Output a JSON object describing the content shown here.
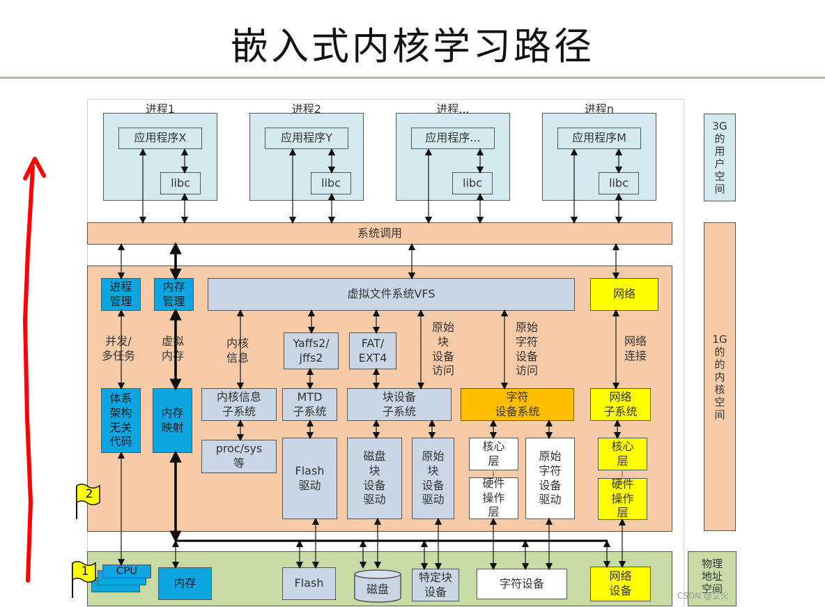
{
  "title": "嵌入式内核学习路径",
  "user_space": {
    "side_label": "3G\n的\n用\n户\n空\n间",
    "processes": [
      {
        "label": "进程1",
        "app": "应用程序X",
        "libc": "libc"
      },
      {
        "label": "进程2",
        "app": "应用程序Y",
        "libc": "libc"
      },
      {
        "label": "进程...",
        "app": "应用程序...",
        "libc": "libc"
      },
      {
        "label": "进程n",
        "app": "应用程序M",
        "libc": "libc"
      }
    ]
  },
  "syscall": {
    "label": "系统调用"
  },
  "kernel": {
    "side_label": "1G\n的\n的\n内\n核\n空\n间",
    "process_mgmt": "进程\n管理",
    "memory_mgmt": "内存\n管理",
    "vfs": "虚拟文件系统VFS",
    "network": "网络",
    "edge_labels": {
      "concurrency": "并发/\n多任务",
      "virtual_memory": "虚拟\n内存",
      "kernel_info": "内核\n信息",
      "raw_block_access": "原始\n块\n设备\n访问",
      "raw_char_access": "原始\n字符\n设备\n访问",
      "net_connect": "网络\n连接"
    },
    "yaffs": "Yaffs2/\njffs2",
    "fat": "FAT/\nEXT4",
    "arch_code": "体系\n架构\n无关\n代码",
    "mem_map": "内存\n映射",
    "kinfo_subsys": "内核信息\n子系统",
    "mtd_subsys": "MTD\n子系统",
    "block_subsys": "块设备\n子系统",
    "char_subsys": "字符\n设备系统",
    "net_subsys": "网络\n子系统",
    "procsys": "proc/sys\n等",
    "flash_driver": "Flash\n驱动",
    "disk_driver": "磁盘\n块\n设备\n驱动",
    "raw_block_driver": "原始\n块\n设备\n驱动",
    "char_core": "核心\n层",
    "char_hw": "硬件\n操作\n层",
    "raw_char_driver": "原始\n字符\n设备\n驱动",
    "net_core": "核心\n层",
    "net_hw": "硬件\n操作\n层"
  },
  "hardware": {
    "side_label": "物理\n地址\n空间",
    "cpu": "CPU",
    "memory": "内存",
    "flash": "Flash",
    "disk": "磁盘",
    "special_block": "特定块\n设备",
    "char_device": "字符设备",
    "net_device": "网络\n设备"
  },
  "flags": [
    {
      "label": "1"
    },
    {
      "label": "2"
    }
  ],
  "watermark": "CSDN @艾火",
  "colors": {
    "arrow": "#ff0000",
    "kernel_bg": "#f8cba8",
    "hardware_bg": "#c9dba5",
    "user_bg": "#d5eaf0",
    "blue": "#0ea5e0",
    "yellow": "#ffff00",
    "orange": "#ffbf00",
    "grey": "#c8d6e5"
  }
}
